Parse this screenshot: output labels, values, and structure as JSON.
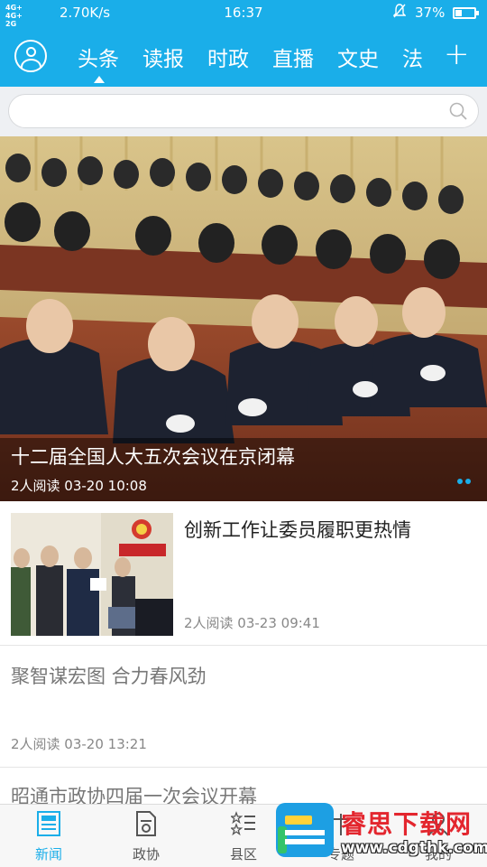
{
  "status_bar": {
    "network": "4G+ 4G+ 2G",
    "speed": "2.70K/s",
    "time": "16:37",
    "battery_percent": "37%",
    "battery_level": 0.37,
    "bell_icon": "muted-bell-icon"
  },
  "header": {
    "accent_color": "#1aaee9",
    "active_tab_index": 0,
    "tabs": [
      {
        "label": "头条"
      },
      {
        "label": "读报"
      },
      {
        "label": "时政"
      },
      {
        "label": "直播"
      },
      {
        "label": "文史"
      },
      {
        "label": "法"
      }
    ],
    "plus_label": "+"
  },
  "search": {
    "placeholder": "",
    "icon": "search-icon"
  },
  "banner": {
    "title": "十二届全国人大五次会议在京闭幕",
    "meta": "2人阅读  03-20 10:08"
  },
  "news": [
    {
      "title": "创新工作让委员履职更热情",
      "meta": "2人阅读  03-23 09:41"
    },
    {
      "title": "聚智谋宏图 合力春风劲",
      "meta": "2人阅读  03-20 13:21"
    },
    {
      "title": "昭通市政协四届一次会议开幕"
    }
  ],
  "bottom_nav": [
    {
      "label": "新闻",
      "icon": "newspaper-icon",
      "active": true
    },
    {
      "label": "政协",
      "icon": "document-icon",
      "active": false
    },
    {
      "label": "县区",
      "icon": "star-list-icon",
      "active": false
    },
    {
      "label": "专题",
      "icon": "topic-icon",
      "active": false
    },
    {
      "label": "我的",
      "icon": "user-icon",
      "active": false
    }
  ],
  "watermark": {
    "name": "睿思下载网",
    "url": "www.cdgthk.com"
  }
}
